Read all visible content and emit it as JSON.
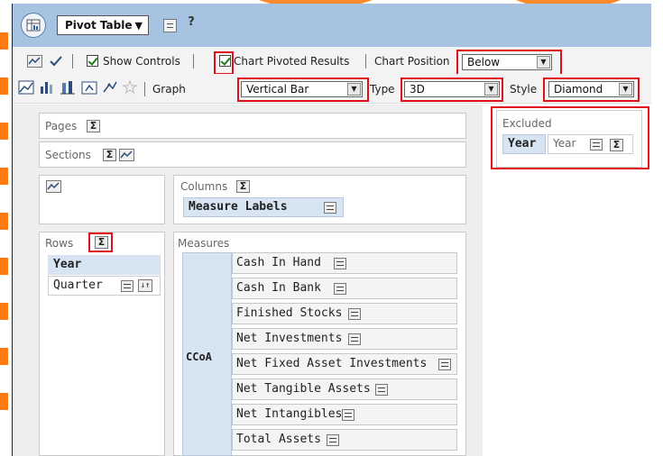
{
  "toolbar_top": {
    "view_button_label": "Pivot Table",
    "help_label": "?"
  },
  "controls": {
    "show_controls_label": "Show Controls",
    "chart_pivoted_label": "Chart Pivoted Results",
    "chart_position_label": "Chart Position",
    "chart_position_value": "Below"
  },
  "graph_controls": {
    "graph_label": "Graph",
    "graph_value": "Vertical Bar",
    "type_label": "Type",
    "type_value": "3D",
    "style_label": "Style",
    "style_value": "Diamond"
  },
  "layout": {
    "pages_label": "Pages",
    "sections_label": "Sections",
    "columns_label": "Columns",
    "columns_chip": "Measure Labels",
    "rows_label": "Rows",
    "rows_items": [
      "Year",
      "Quarter"
    ],
    "measures_label": "Measures",
    "measures_group": "CCoA",
    "measures": [
      "Cash In Hand",
      "Cash In Bank",
      "Finished Stocks",
      "Net Investments",
      "Net Fixed Asset Investments",
      "Net Tangible Assets",
      "Net Intangibles",
      "Total Assets"
    ],
    "excluded_label": "Excluded",
    "excluded_chip_bold": "Year",
    "excluded_chip": "Year"
  },
  "colors": {
    "title_bar": "#a6c4e1",
    "highlight": "#e0101b",
    "background_accent": "#fb8a2c"
  }
}
